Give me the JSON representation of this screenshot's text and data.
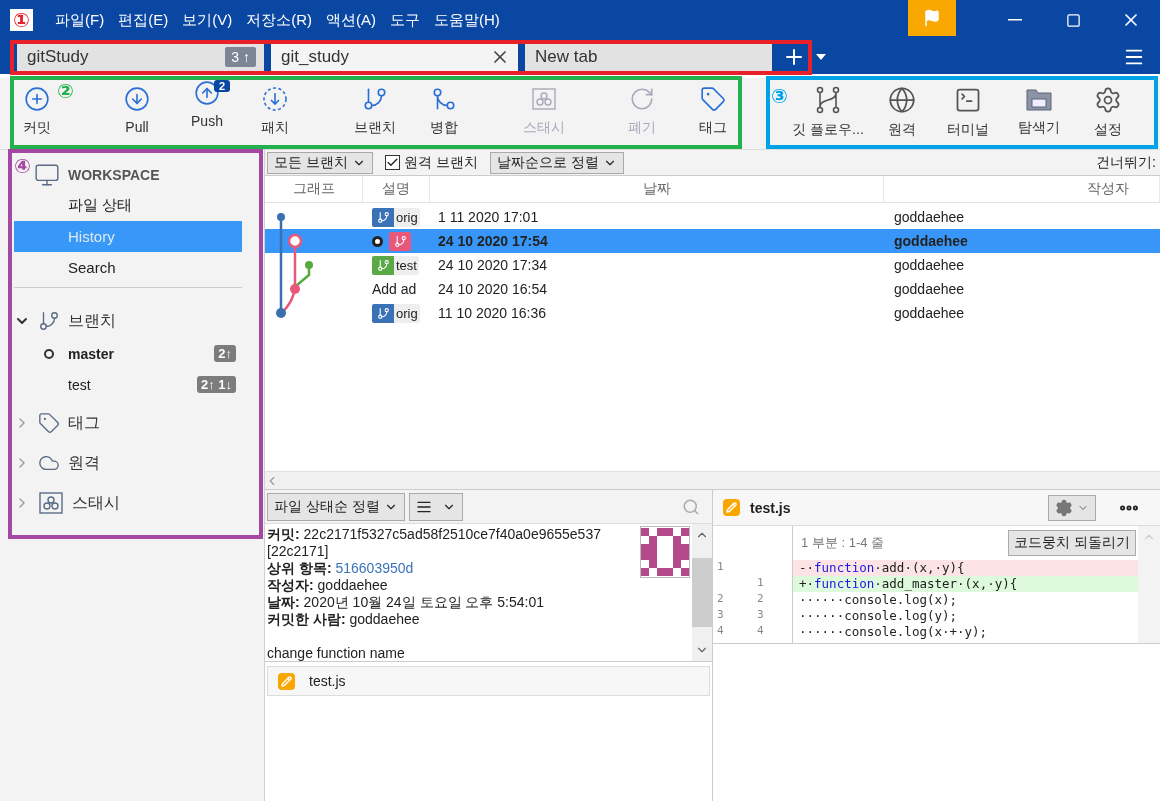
{
  "menu": [
    "파일(F)",
    "편집(E)",
    "보기(V)",
    "저장소(R)",
    "액션(A)",
    "도구",
    "도움말(H)"
  ],
  "tabs": [
    {
      "label": "gitStudy",
      "badge": "3 ↑",
      "selected": false
    },
    {
      "label": "git_study",
      "selected": true
    },
    {
      "label": "New tab",
      "selected": false
    }
  ],
  "toolbar": {
    "left": [
      {
        "label": "커밋",
        "kind": "commit",
        "disabled": false
      },
      {
        "label": "Pull",
        "kind": "pull",
        "disabled": false
      },
      {
        "label": "Push",
        "kind": "push",
        "disabled": false,
        "badge": "2"
      },
      {
        "label": "패치",
        "kind": "fetch",
        "disabled": false
      },
      {
        "label": "브랜치",
        "kind": "branch",
        "disabled": false
      },
      {
        "label": "병합",
        "kind": "merge",
        "disabled": false
      },
      {
        "label": "스태시",
        "kind": "stash",
        "disabled": true
      },
      {
        "label": "폐기",
        "kind": "discard",
        "disabled": true
      },
      {
        "label": "태그",
        "kind": "tag",
        "disabled": false
      }
    ],
    "right": [
      {
        "label": "깃 플로우...",
        "kind": "flow",
        "disabled": false
      },
      {
        "label": "원격",
        "kind": "globe",
        "disabled": false
      },
      {
        "label": "터미널",
        "kind": "terminal",
        "disabled": false
      },
      {
        "label": "탐색기",
        "kind": "explorer",
        "disabled": false
      },
      {
        "label": "설정",
        "kind": "settings",
        "disabled": false
      }
    ]
  },
  "sidebar": {
    "workspace": "WORKSPACE",
    "items": [
      {
        "label": "파일 상태",
        "selected": false
      },
      {
        "label": "History",
        "selected": true
      },
      {
        "label": "Search",
        "selected": false
      }
    ],
    "sections": [
      {
        "label": "브랜치",
        "kind": "branch",
        "expanded": true,
        "children": [
          {
            "label": "master",
            "current": true,
            "badge": "2↑"
          },
          {
            "label": "test",
            "current": false,
            "badge": "2↑ 1↓"
          }
        ]
      },
      {
        "label": "태그",
        "kind": "tag",
        "expanded": false
      },
      {
        "label": "원격",
        "kind": "cloud",
        "expanded": false
      },
      {
        "label": "스태시",
        "kind": "stash",
        "expanded": false
      }
    ]
  },
  "filters": {
    "branches": "모든 브랜치",
    "remote_branches": {
      "label": "원격 브랜치",
      "checked": true
    },
    "sort": "날짜순으로 정렬",
    "skip": "건너뛰기:"
  },
  "columns": [
    "그래프",
    "설명",
    "날짜",
    "작성자"
  ],
  "commits": [
    {
      "ref": {
        "label": "orig",
        "color": "#3a72b5"
      },
      "date": "1 11 2020 17:01",
      "author": "goddaehee",
      "selected": false,
      "head": false,
      "color": "#3a6fb0"
    },
    {
      "ref": {
        "color": "#e8587a"
      },
      "date": "24 10 2020 17:54",
      "author": "goddaehee",
      "selected": true,
      "head": true,
      "color": "#e8587a"
    },
    {
      "ref": {
        "label": "test",
        "color": "#5aa846"
      },
      "date": "24 10 2020 17:34",
      "author": "goddaehee",
      "selected": false,
      "head": false,
      "color": "#55a83e"
    },
    {
      "description": "Add ad",
      "date": "24 10 2020 16:54",
      "author": "goddaehee",
      "selected": false,
      "head": false,
      "color": "#e8587a"
    },
    {
      "ref": {
        "label": "orig",
        "color": "#3a72b5"
      },
      "date": "11 10 2020 16:36",
      "author": "goddaehee",
      "selected": false,
      "head": false,
      "color": "#3a6fb0"
    }
  ],
  "details": {
    "sort": "파일 상태순 정렬",
    "lines": [
      {
        "label": "커밋:",
        "value": "22c2171f5327c5ad58f2510ce7f40a0e9655e537",
        "kind": "text"
      },
      {
        "value": "[22c2171]",
        "kind": "text"
      },
      {
        "label": "상위 항목:",
        "value": "516603950d",
        "kind": "link"
      },
      {
        "label": "작성자:",
        "value": "goddaehee",
        "kind": "text"
      },
      {
        "label": "날짜:",
        "value": "2020년 10월 24일 토요일 오후 5:54:01",
        "kind": "text"
      },
      {
        "label": "커밋한 사람:",
        "value": "goddaehee",
        "kind": "text"
      }
    ],
    "message": "change function name",
    "files": [
      {
        "name": "test.js",
        "kind": "modified"
      }
    ]
  },
  "diff": {
    "file": "test.js",
    "hunk": "1 부분 : 1-4 줄",
    "revert": "코드뭉치 되돌리기",
    "lines": [
      {
        "kind": "removed",
        "old": "1",
        "code": [
          {
            "text": "-·",
            "kind": "plain"
          },
          {
            "text": "function",
            "kind": "keyword"
          },
          {
            "text": "·add·(x,·y){",
            "kind": "plain"
          }
        ]
      },
      {
        "kind": "added",
        "new": "1",
        "code": [
          {
            "text": "+·",
            "kind": "plain"
          },
          {
            "text": "function",
            "kind": "keyword"
          },
          {
            "text": "·add_master·(x,·y){",
            "kind": "plain"
          }
        ]
      },
      {
        "kind": "context",
        "old": "2",
        "new": "2",
        "code": [
          {
            "text": "······console.log(x);",
            "kind": "plain"
          }
        ]
      },
      {
        "kind": "context",
        "old": "3",
        "new": "3",
        "code": [
          {
            "text": "······console.log(y);",
            "kind": "plain"
          }
        ]
      },
      {
        "kind": "context",
        "old": "4",
        "new": "4",
        "code": [
          {
            "text": "······console.log(x·+·y);",
            "kind": "plain"
          }
        ]
      }
    ]
  },
  "annotations": [
    {
      "number": "①",
      "color": "#e8202a"
    },
    {
      "number": "②",
      "color": "#22b14c"
    },
    {
      "number": "③",
      "color": "#00a2e8"
    },
    {
      "number": "④",
      "color": "#a349a4"
    }
  ]
}
